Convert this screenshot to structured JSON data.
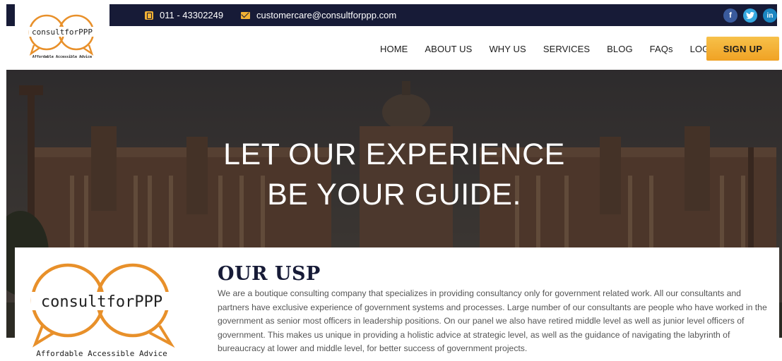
{
  "topbar": {
    "phone": "011 - 43302249",
    "email": "customercare@consultforppp.com",
    "social": [
      {
        "name": "facebook",
        "glyph": "f"
      },
      {
        "name": "twitter",
        "glyph": "t"
      },
      {
        "name": "linkedin",
        "glyph": "in"
      }
    ]
  },
  "logo": {
    "wordmark": "consultforPPP",
    "tagline": "Affordable Accessible Advice",
    "ring_color": "#e8902a"
  },
  "nav": {
    "items": [
      "HOME",
      "ABOUT US",
      "WHY US",
      "SERVICES",
      "BLOG",
      "FAQs",
      "LOGIN"
    ],
    "signup": "SIGN UP"
  },
  "hero": {
    "line1": "LET OUR EXPERIENCE",
    "line2": "BE YOUR GUIDE."
  },
  "usp": {
    "title": "OUR USP",
    "body": "We are a boutique consulting company that specializes in providing consultancy only for government related work. All our consultants and partners have exclusive experience of government systems and processes. Large number of our consultants are people who have worked in the government as senior most officers in leadership positions. On our panel we also have retired middle level as well as junior level officers of government. This makes us unique in providing a holistic advice at strategic level, as well as the guidance of navigating the labyrinth of bureaucracy at lower and middle level, for better success of government projects."
  },
  "colors": {
    "topbar": "#171b37",
    "accent": "#f2b134",
    "signup": "#f0a224"
  }
}
